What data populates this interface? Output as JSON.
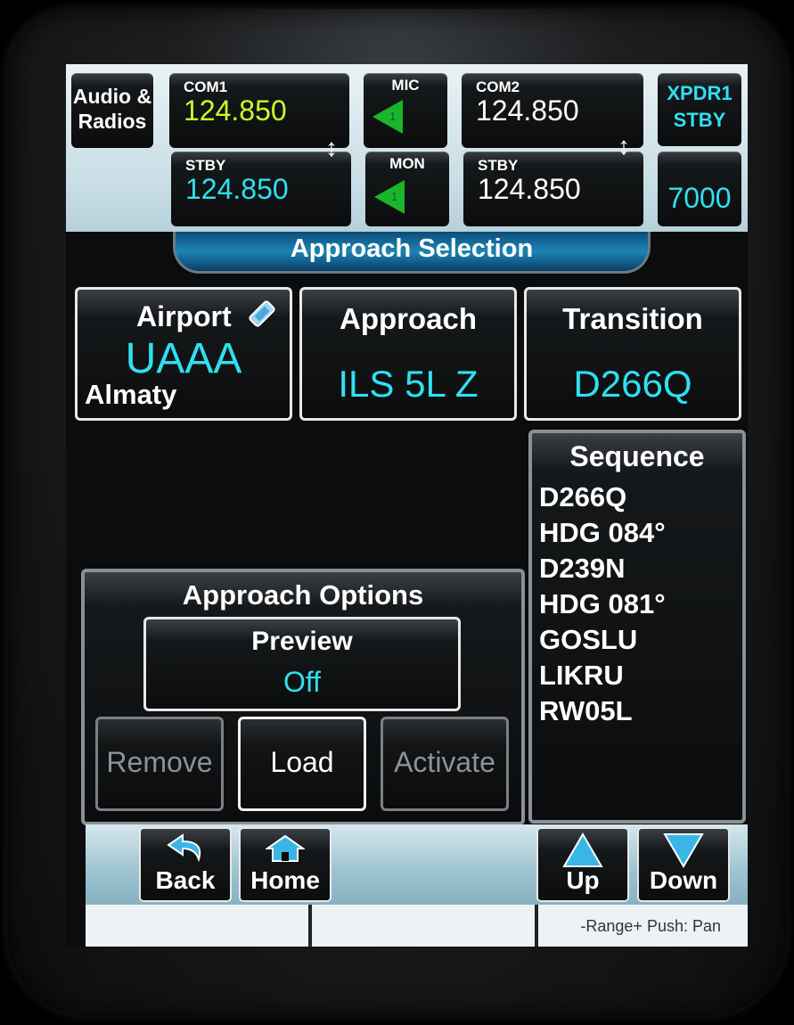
{
  "header": {
    "audio_radios": "Audio &\nRadios",
    "com1": {
      "label": "COM1",
      "freq": "124.850"
    },
    "com1_stby": {
      "label": "STBY",
      "freq": "124.850"
    },
    "com2": {
      "label": "COM2",
      "freq": "124.850"
    },
    "com2_stby": {
      "label": "STBY",
      "freq": "124.850"
    },
    "mic": {
      "label": "MIC",
      "num": "1"
    },
    "mon": {
      "label": "MON",
      "num": "1"
    },
    "xpdr": {
      "label": "XPDR1",
      "mode": "STBY",
      "code": "7000"
    }
  },
  "banner": "Approach Selection",
  "airport": {
    "label": "Airport",
    "code": "UAAA",
    "name": "Almaty"
  },
  "approach": {
    "label": "Approach",
    "value": "ILS 5L Z"
  },
  "transition": {
    "label": "Transition",
    "value": "D266Q"
  },
  "sequence": {
    "title": "Sequence",
    "items": [
      "D266Q",
      "HDG 084°",
      "D239N",
      "HDG 081°",
      "GOSLU",
      "LIKRU",
      "RW05L"
    ]
  },
  "options": {
    "title": "Approach Options",
    "preview_label": "Preview",
    "preview_value": "Off",
    "remove": "Remove",
    "load": "Load",
    "activate": "Activate"
  },
  "nav": {
    "back": "Back",
    "home": "Home",
    "up": "Up",
    "down": "Down"
  },
  "status": {
    "hint": "-Range+ Push: Pan"
  },
  "colors": {
    "cyan": "#2fe0f0",
    "green": "#c8ff2a",
    "mic_green": "#19b52b"
  }
}
